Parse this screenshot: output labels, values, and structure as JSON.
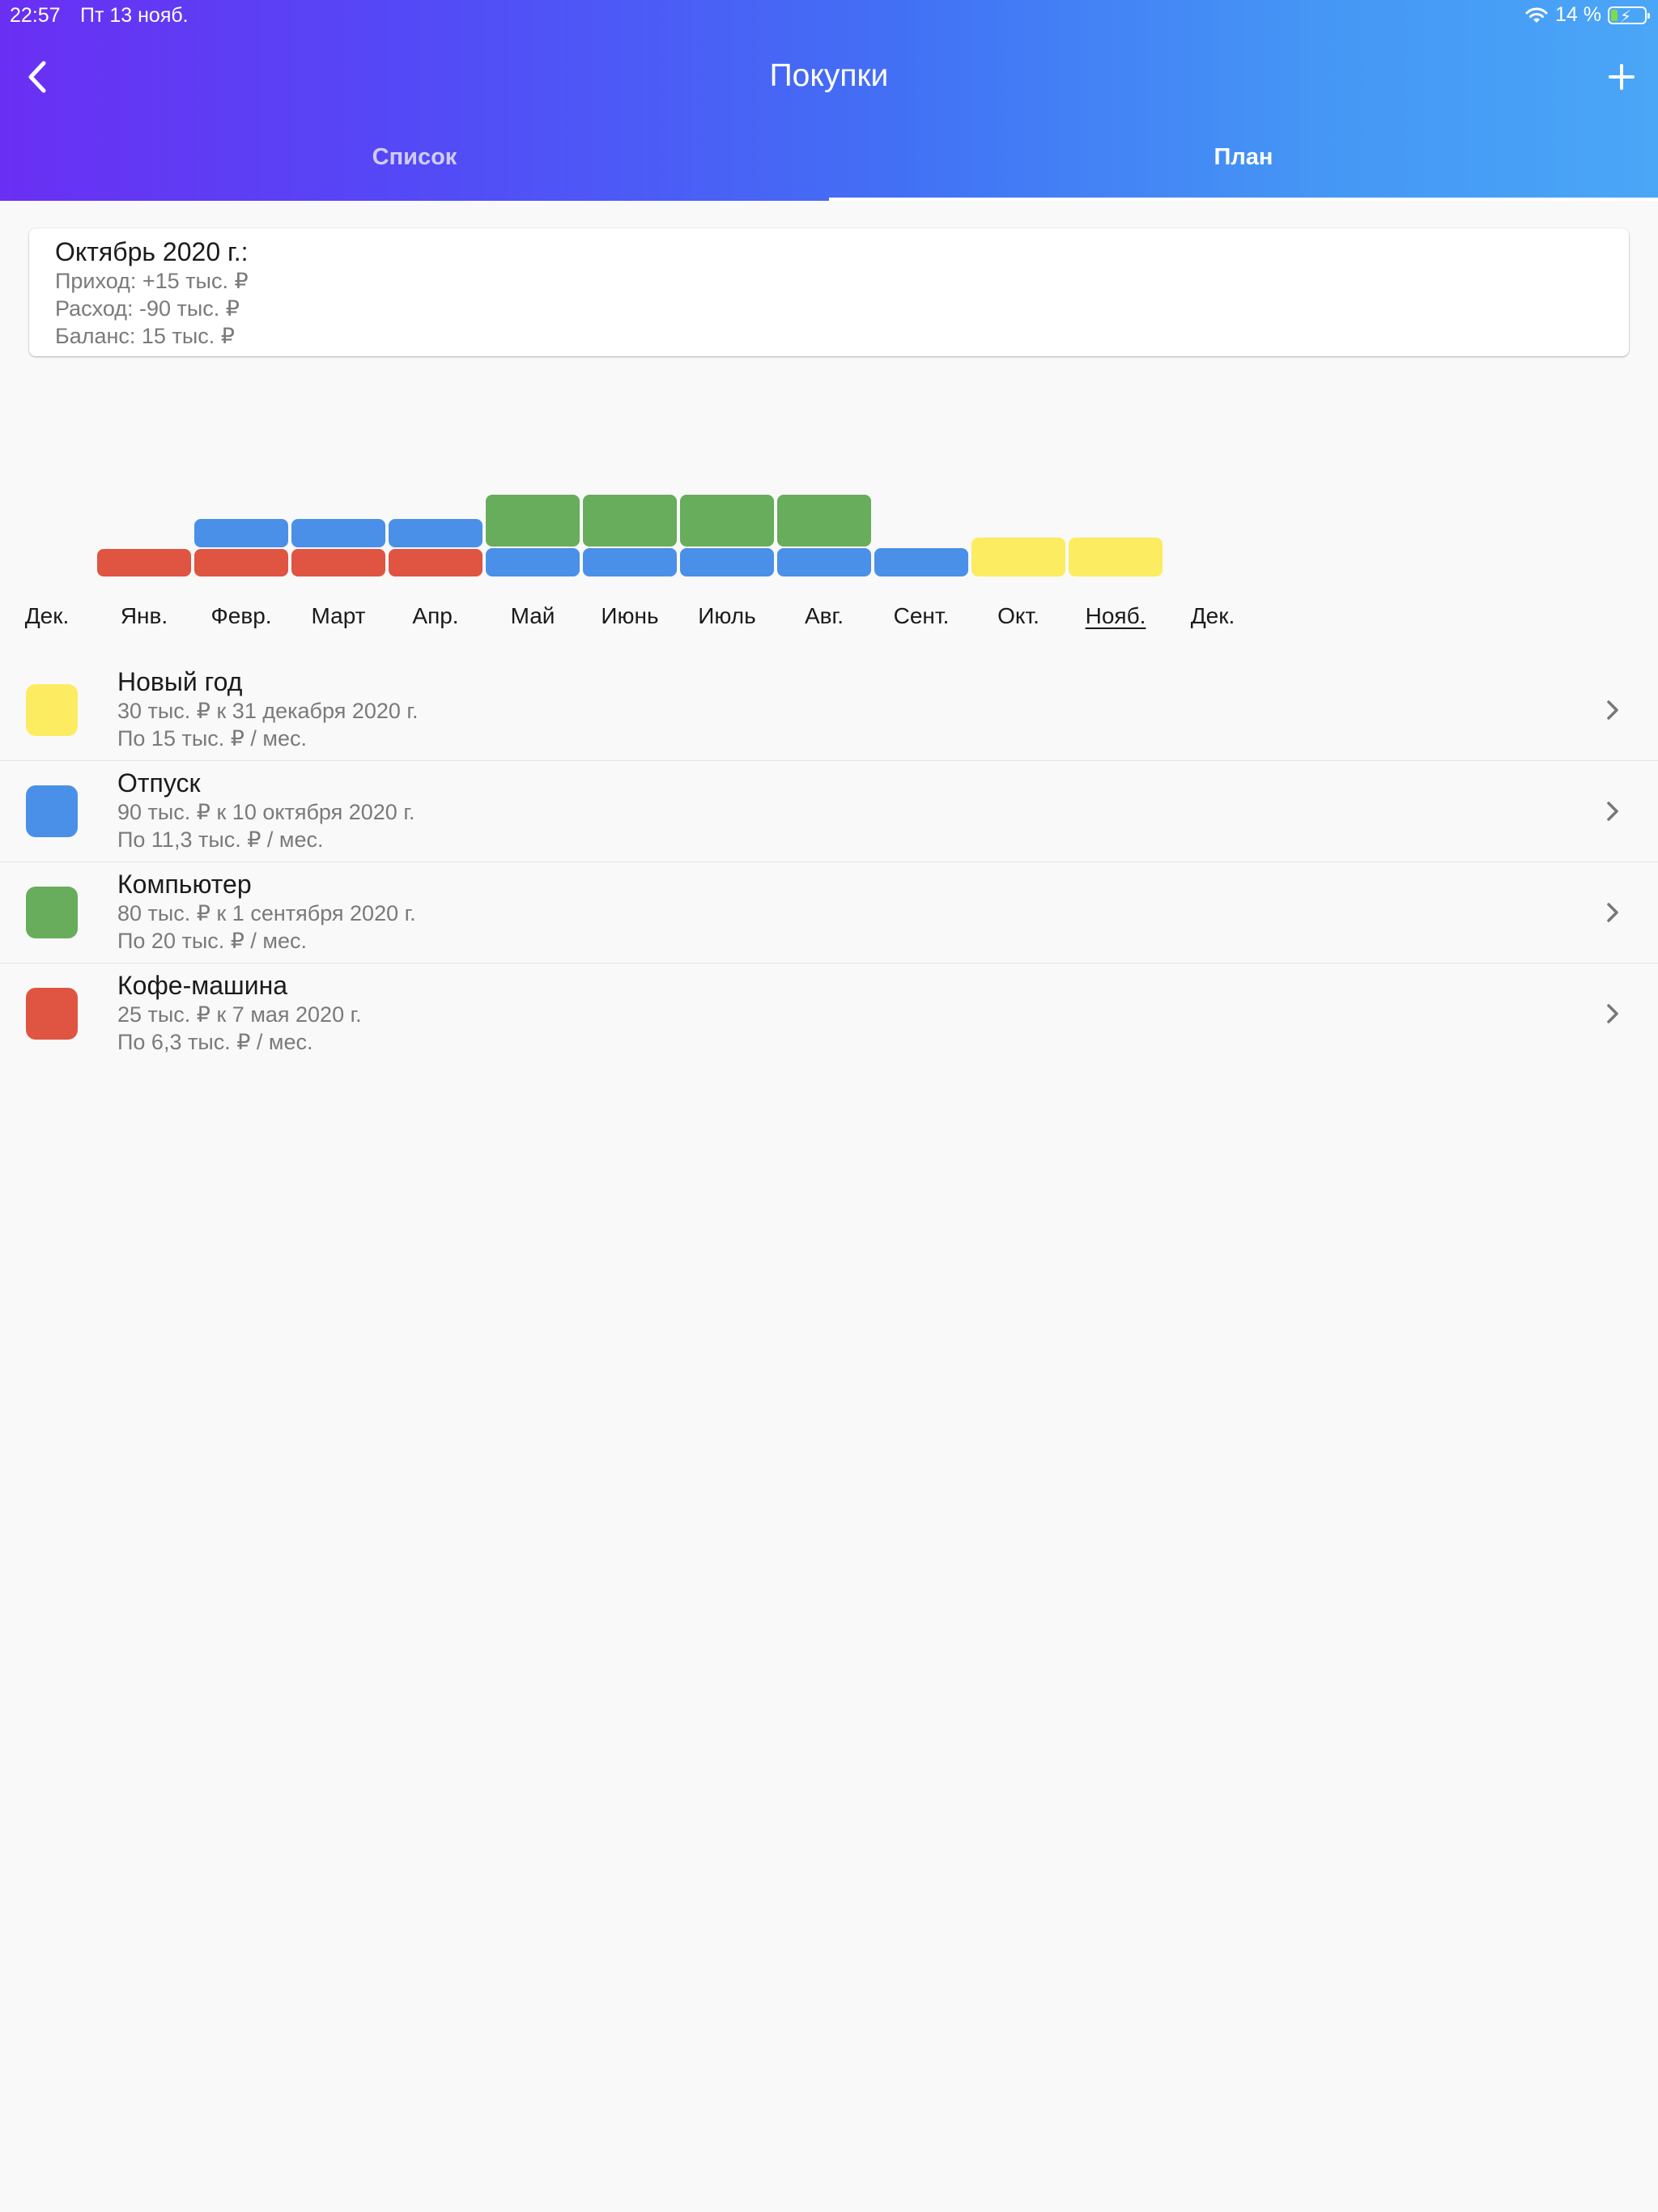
{
  "status": {
    "time": "22:57",
    "date": "Пт 13 нояб.",
    "battery": "14 %"
  },
  "header": {
    "title": "Покупки"
  },
  "tabs": [
    {
      "label": "Список",
      "active": false
    },
    {
      "label": "План",
      "active": true
    }
  ],
  "summary": {
    "title": "Октябрь 2020 г.:",
    "income": "Приход: +15 тыс. ₽",
    "expense": "Расход: -90 тыс. ₽",
    "balance": "Баланс: 15 тыс. ₽"
  },
  "months": [
    "Дек.",
    "Янв.",
    "Февр.",
    "Март",
    "Апр.",
    "Май",
    "Июнь",
    "Июль",
    "Авг.",
    "Сент.",
    "Окт.",
    "Нояб.",
    "Дек."
  ],
  "current_month_index": 11,
  "colors": {
    "yellow": "#fcec61",
    "blue": "#4a90e8",
    "green": "#67ad5b",
    "red": "#e05442"
  },
  "goals": [
    {
      "name": "Новый год",
      "target": "30 тыс. ₽ к 31 декабря 2020 г.",
      "monthly": "По 15 тыс. ₽ / мес.",
      "color": "#fcec61"
    },
    {
      "name": "Отпуск",
      "target": "90 тыс. ₽ к 10 октября 2020 г.",
      "monthly": "По 11,3 тыс. ₽ / мес.",
      "color": "#4a90e8"
    },
    {
      "name": "Компьютер",
      "target": "80 тыс. ₽ к 1 сентября 2020 г.",
      "monthly": "По 20 тыс. ₽ / мес.",
      "color": "#67ad5b"
    },
    {
      "name": "Кофе-машина",
      "target": "25 тыс. ₽ к 7 мая 2020 г.",
      "monthly": "По 6,3 тыс. ₽ / мес.",
      "color": "#e05442"
    }
  ],
  "chart_data": {
    "type": "bar",
    "stacked": true,
    "unit": "тыс. ₽",
    "categories": [
      "Дек.",
      "Янв.",
      "Февр.",
      "Март",
      "Апр.",
      "Май",
      "Июнь",
      "Июль",
      "Авг.",
      "Сент.",
      "Окт.",
      "Нояб.",
      "Дек."
    ],
    "series": [
      {
        "name": "Кофе-машина",
        "color": "#e05442",
        "values": [
          0,
          6.3,
          6.3,
          6.3,
          6.3,
          0,
          0,
          0,
          0,
          0,
          0,
          0,
          0
        ]
      },
      {
        "name": "Отпуск",
        "color": "#4a90e8",
        "values": [
          0,
          0,
          11.3,
          11.3,
          11.3,
          11.3,
          11.3,
          11.3,
          11.3,
          11.3,
          0,
          0,
          0
        ]
      },
      {
        "name": "Компьютер",
        "color": "#67ad5b",
        "values": [
          0,
          0,
          0,
          0,
          0,
          20,
          20,
          20,
          20,
          0,
          0,
          0,
          0
        ]
      },
      {
        "name": "Новый год",
        "color": "#fcec61",
        "values": [
          0,
          0,
          0,
          0,
          0,
          0,
          0,
          0,
          0,
          0,
          15,
          15,
          0
        ]
      }
    ]
  }
}
